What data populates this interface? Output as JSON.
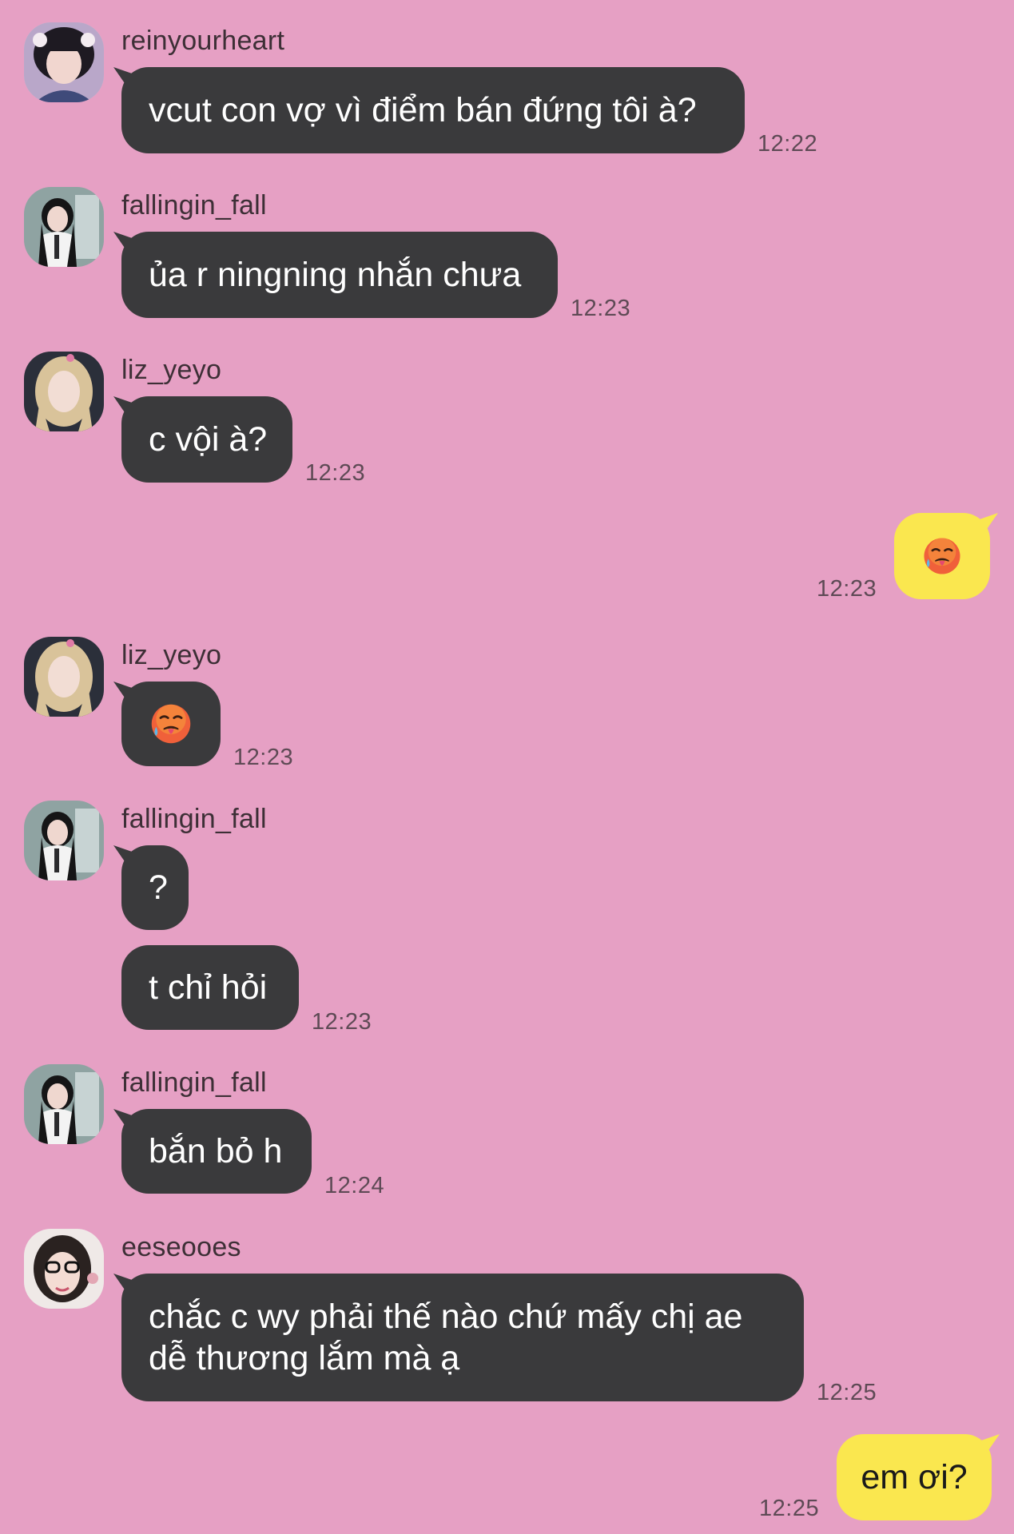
{
  "messages": [
    {
      "sender": "reinyourheart",
      "text": "vcut con vợ vì điểm bán đứng tôi à?",
      "time": "12:22"
    },
    {
      "sender": "fallingin_fall",
      "text": "ủa r ningning nhắn chưa",
      "time": "12:23"
    },
    {
      "sender": "liz_yeyo",
      "text": "c vội à?",
      "time": "12:23"
    },
    {
      "sender": "me",
      "emoji": "hot-face-emoji",
      "time": "12:23"
    },
    {
      "sender": "liz_yeyo",
      "emoji": "hot-face-emoji",
      "time": "12:23"
    },
    {
      "sender": "fallingin_fall",
      "text": "?",
      "time": ""
    },
    {
      "sender": "fallingin_fall",
      "text": "t chỉ hỏi",
      "time": "12:23"
    },
    {
      "sender": "fallingin_fall",
      "text": "bắn bỏ h",
      "time": "12:24"
    },
    {
      "sender": "eeseooes",
      "text": "chắc c wy phải thế nào chứ mấy chị ae dễ thương lắm mà ạ",
      "time": "12:25"
    },
    {
      "sender": "me",
      "text": "em ơi?",
      "time": "12:25"
    }
  ],
  "colors": {
    "background": "#e6a0c4",
    "incoming_bubble": "#3a3a3c",
    "outgoing_bubble": "#fae74f"
  }
}
